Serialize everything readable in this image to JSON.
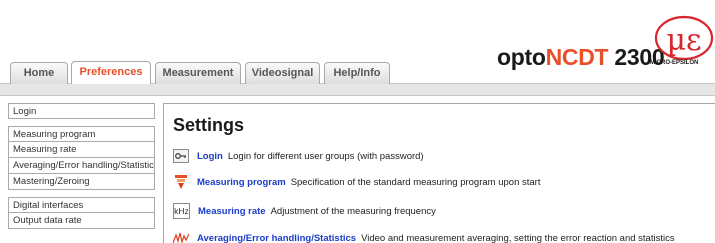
{
  "tabs": [
    {
      "label": "Home",
      "active": false
    },
    {
      "label": "Preferences",
      "active": true
    },
    {
      "label": "Measurement",
      "active": false
    },
    {
      "label": "Videosignal",
      "active": false
    },
    {
      "label": "Help/Info",
      "active": false
    }
  ],
  "brand": {
    "prefix": "opto",
    "accent": "NCDT",
    "suffix": " 2300",
    "accent_color": "#e8502a"
  },
  "logo": {
    "symbol": "µε",
    "text": "MICRO-EPSILON",
    "color": "#d8262d"
  },
  "sidebar": {
    "groups": [
      [
        "Login"
      ],
      [
        "Measuring program",
        "Measuring rate",
        "Averaging/Error handling/Statistics",
        "Mastering/Zeroing"
      ],
      [
        "Digital interfaces",
        "Output data rate"
      ]
    ]
  },
  "content": {
    "title": "Settings",
    "entries": [
      {
        "icon": "key-icon",
        "link": "Login",
        "description": "Login for different user groups (with password)"
      },
      {
        "icon": "measuring-program-icon",
        "link": "Measuring program",
        "description": "Specification of the standard measuring program upon start"
      },
      {
        "icon": "khz-icon",
        "icon_text": "kHz",
        "link": "Measuring rate",
        "description": "Adjustment of the measuring frequency"
      },
      {
        "icon": "statistics-icon",
        "link": "Averaging/Error handling/Statistics",
        "description": "Video and measurement averaging, setting the error reaction and statistics"
      }
    ]
  }
}
